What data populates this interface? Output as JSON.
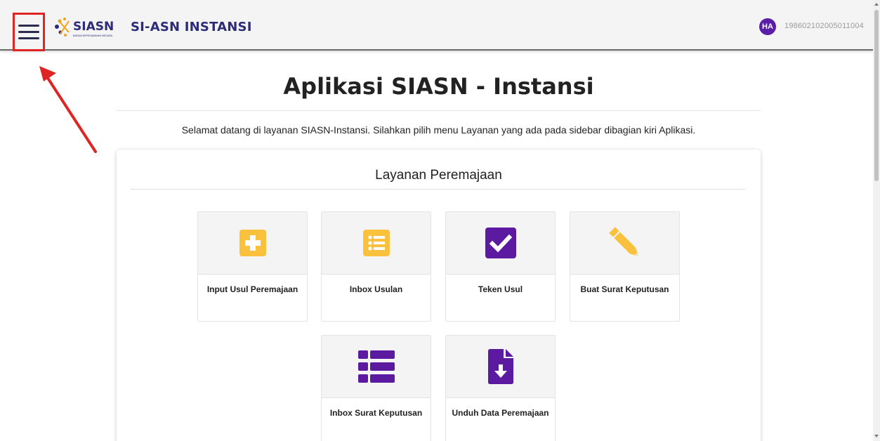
{
  "header": {
    "app_title": "SI-ASN INSTANSI",
    "logo_text": "SIASN",
    "logo_subtext": "BADAN KEPEGAWAIAN NEGARA",
    "avatar_initials": "HA",
    "user_id": "198602102005011004",
    "menu_icon": "hamburger-icon"
  },
  "main": {
    "title": "Aplikasi SIASN - Instansi",
    "welcome": "Selamat datang di layanan SIASN-Instansi. Silahkan pilih menu Layanan yang ada pada sidebar dibagian kiri Aplikasi."
  },
  "panel": {
    "title": "Layanan Peremajaan",
    "cards": [
      {
        "label": "Input Usul Peremajaan",
        "icon": "plus-square-icon",
        "color": "#f9c13c"
      },
      {
        "label": "Inbox Usulan",
        "icon": "list-icon",
        "color": "#f9c13c"
      },
      {
        "label": "Teken Usul",
        "icon": "check-square-icon",
        "color": "#5b1aa0"
      },
      {
        "label": "Buat Surat Keputusan",
        "icon": "pencil-icon",
        "color": "#f9c13c"
      },
      {
        "label": "Inbox Surat Keputusan",
        "icon": "table-list-icon",
        "color": "#5b1aa0"
      },
      {
        "label": "Unduh Data Peremajaan",
        "icon": "file-download-icon",
        "color": "#5b1aa0"
      }
    ]
  },
  "colors": {
    "accent_yellow": "#f9c13c",
    "accent_purple": "#5b1aa0",
    "brand_navy": "#2e2c7a",
    "annotation_red": "#e02424"
  }
}
